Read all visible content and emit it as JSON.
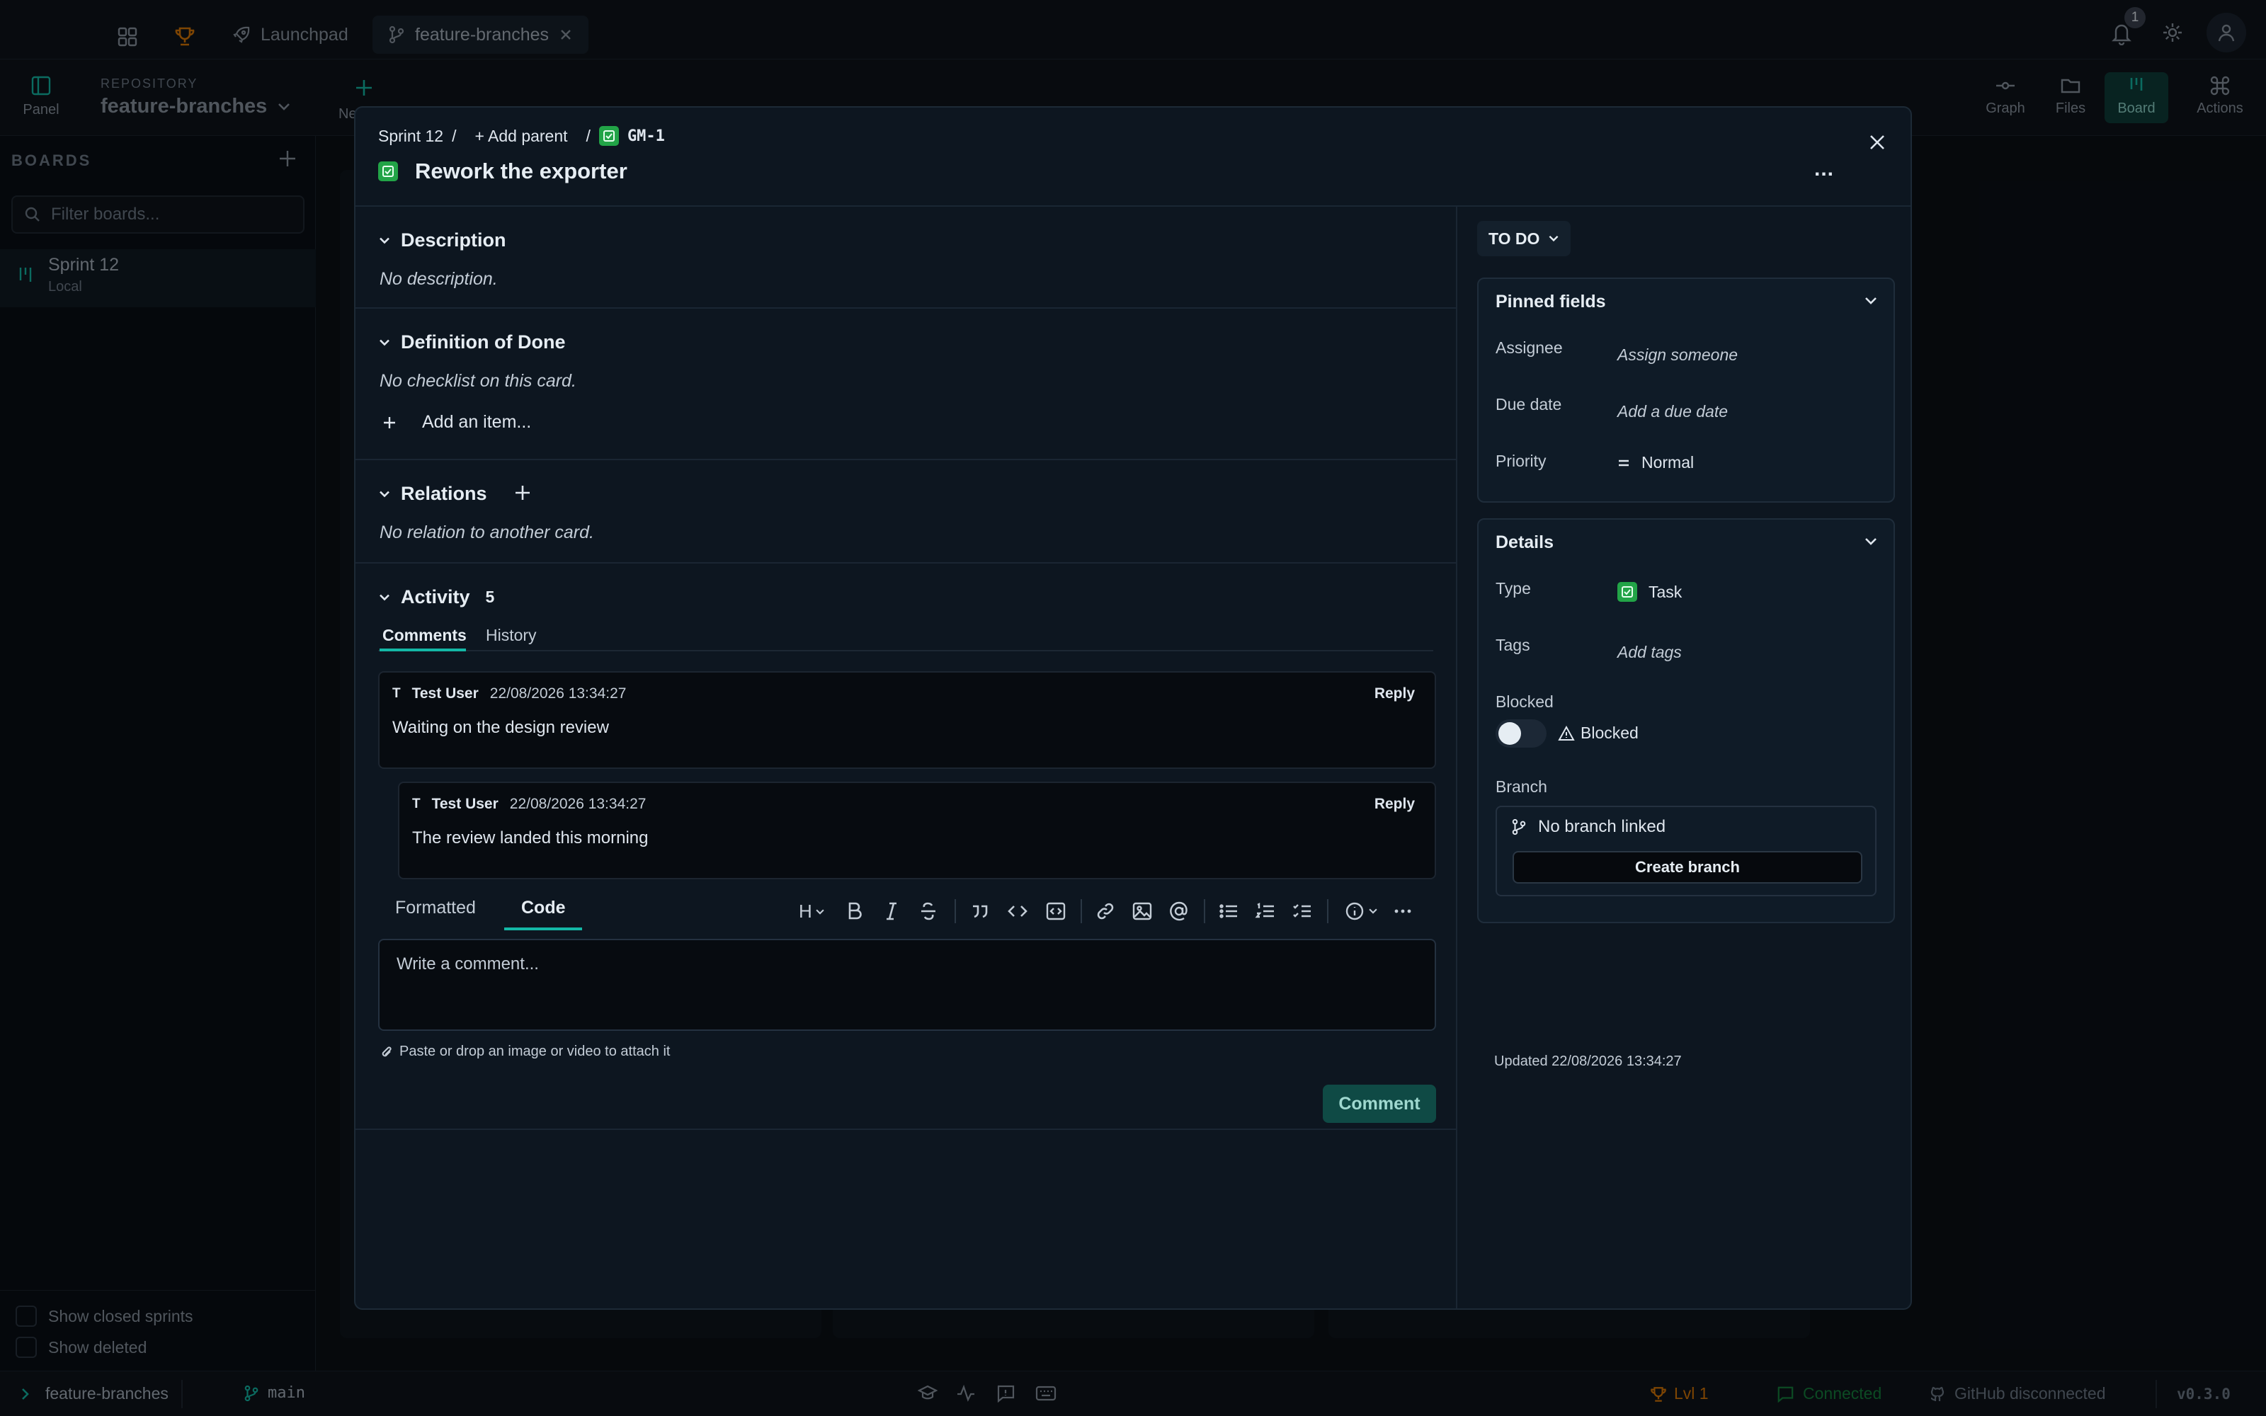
{
  "app": {
    "tabs": [
      {
        "label": "Launchpad"
      },
      {
        "label": "feature-branches"
      }
    ],
    "notifications_count": "1",
    "toolbar": {
      "panel_label": "Panel",
      "repo_caption": "REPOSITORY",
      "repo_name": "feature-branches",
      "new_label": "Ne",
      "views": [
        {
          "label": "Graph"
        },
        {
          "label": "Files"
        },
        {
          "label": "Board"
        },
        {
          "label": "Actions"
        }
      ]
    },
    "sidebar": {
      "heading": "BOARDS",
      "filter_placeholder": "Filter boards...",
      "boards": [
        {
          "name": "Sprint 12",
          "source": "Local"
        }
      ],
      "show_closed": "Show closed sprints",
      "show_deleted": "Show deleted"
    },
    "statusbar": {
      "repo": "feature-branches",
      "branch": "main",
      "level": "Lvl 1",
      "connection": "Connected",
      "github": "GitHub disconnected",
      "version": "v0.3.0"
    }
  },
  "card": {
    "breadcrumb_sprint": "Sprint 12",
    "sep": "/",
    "add_parent": "+ Add parent",
    "key": "GM-1",
    "title": "Rework the exporter",
    "more": "...",
    "description": {
      "title": "Description",
      "empty": "No description."
    },
    "dod": {
      "title": "Definition of Done",
      "empty": "No checklist on this card.",
      "add_item": "Add an item..."
    },
    "relations": {
      "title": "Relations",
      "empty": "No relation to another card."
    },
    "activity": {
      "title": "Activity",
      "count": "5",
      "tabs": [
        {
          "label": "Comments"
        },
        {
          "label": "History"
        }
      ],
      "comments": [
        {
          "initial": "T",
          "author": "Test User",
          "time": "22/08/2026 13:34:27",
          "reply": "Reply",
          "text": "Waiting on the design review"
        },
        {
          "initial": "T",
          "author": "Test User",
          "time": "22/08/2026 13:34:27",
          "reply": "Reply",
          "text": "The review landed this morning"
        }
      ],
      "editor": {
        "mode_formatted": "Formatted",
        "mode_code": "Code",
        "heading_btn": "H",
        "placeholder": "Write a comment...",
        "attach_hint": "Paste or drop an image or video to attach it",
        "submit": "Comment"
      }
    },
    "status": "TO DO",
    "pinned": {
      "title": "Pinned fields",
      "assignee_label": "Assignee",
      "assignee_value": "Assign someone",
      "due_label": "Due date",
      "due_value": "Add a due date",
      "priority_label": "Priority",
      "priority_value": "Normal"
    },
    "details": {
      "title": "Details",
      "type_label": "Type",
      "type_value": "Task",
      "tags_label": "Tags",
      "tags_value": "Add tags",
      "blocked_label": "Blocked",
      "blocked_toggle": "Blocked",
      "branch_label": "Branch",
      "branch_value": "No branch linked",
      "create_branch": "Create branch"
    },
    "updated": "Updated 22/08/2026 13:34:27"
  },
  "colors": {
    "accent": "#14b8a6",
    "task_green": "#22a447",
    "level_orange": "#d97706",
    "delete_red": "#dc2626"
  }
}
